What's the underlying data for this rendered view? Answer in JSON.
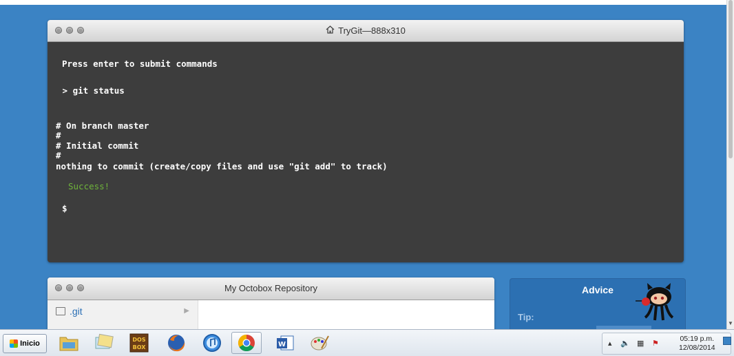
{
  "terminal": {
    "title": "TryGit—888x310",
    "lines": {
      "prompt_hint": "Press enter to submit commands",
      "command": " > git status",
      "out1": "# On branch master",
      "out2": "#",
      "out3": "# Initial commit",
      "out4": "#",
      "out5": "nothing to commit (create/copy files and use \"git add\" to track)",
      "success": "Success!",
      "cursor": "$"
    }
  },
  "repo": {
    "title": "My Octobox Repository",
    "items": [
      {
        "label": ".git"
      }
    ]
  },
  "advice": {
    "title": "Advice",
    "tip_label": "Tip:"
  },
  "taskbar": {
    "start_label": "Inicio",
    "apps": [
      "file-explorer",
      "photos",
      "dosbox",
      "firefox",
      "itunes",
      "chrome",
      "word",
      "paint"
    ],
    "clock_time": "05:19 p.m.",
    "clock_date": "12/08/2014"
  },
  "colors": {
    "desktop": "#3b83c4",
    "terminal_bg": "#3d3d3d",
    "success": "#6fb33b",
    "advice_bg": "#2c70b2"
  }
}
